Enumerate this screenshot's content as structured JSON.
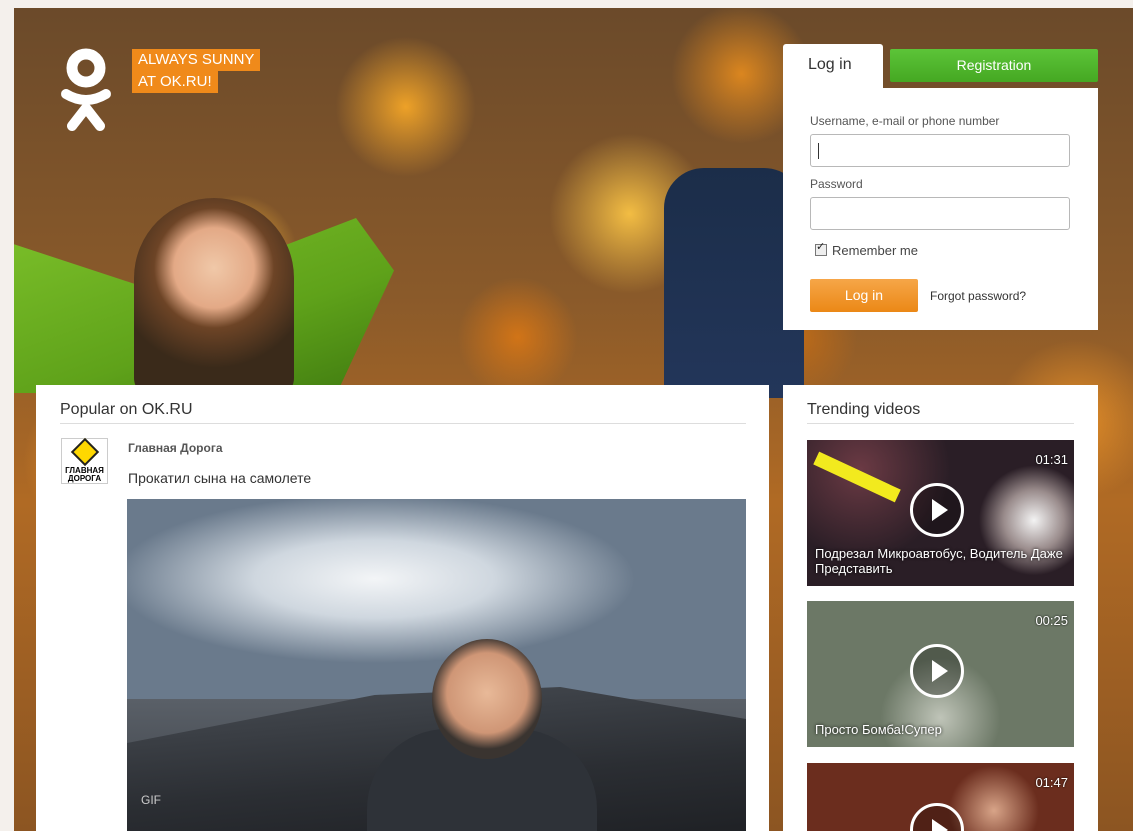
{
  "brand": {
    "slogan_line1": "ALWAYS SUNNY",
    "slogan_line2": "AT OK.RU!"
  },
  "login": {
    "tab_login": "Log in",
    "tab_registration": "Registration",
    "username_label": "Username, e-mail or phone number",
    "username_value": "",
    "password_label": "Password",
    "password_value": "",
    "remember_label": "Remember me",
    "remember_checked": true,
    "submit_label": "Log in",
    "forgot_label": "Forgot password?"
  },
  "popular": {
    "title": "Popular on OK.RU",
    "post": {
      "author": "Главная Дорога",
      "avatar_text": "ГЛАВНАЯ ДОРОГА",
      "text": "Прокатил сына на самолете",
      "media_label": "GIF"
    }
  },
  "trending": {
    "title": "Trending videos",
    "videos": [
      {
        "duration": "01:31",
        "caption": "Подрезал Микроавтобус, Водитель Даже Представить"
      },
      {
        "duration": "00:25",
        "caption": "Просто Бомба!Супер"
      },
      {
        "duration": "01:47",
        "caption": ""
      }
    ]
  },
  "colors": {
    "accent_orange": "#eb8816",
    "accent_green": "#45a822"
  },
  "icons": [
    "ok-logo-icon",
    "play-icon",
    "checkbox-icon"
  ]
}
